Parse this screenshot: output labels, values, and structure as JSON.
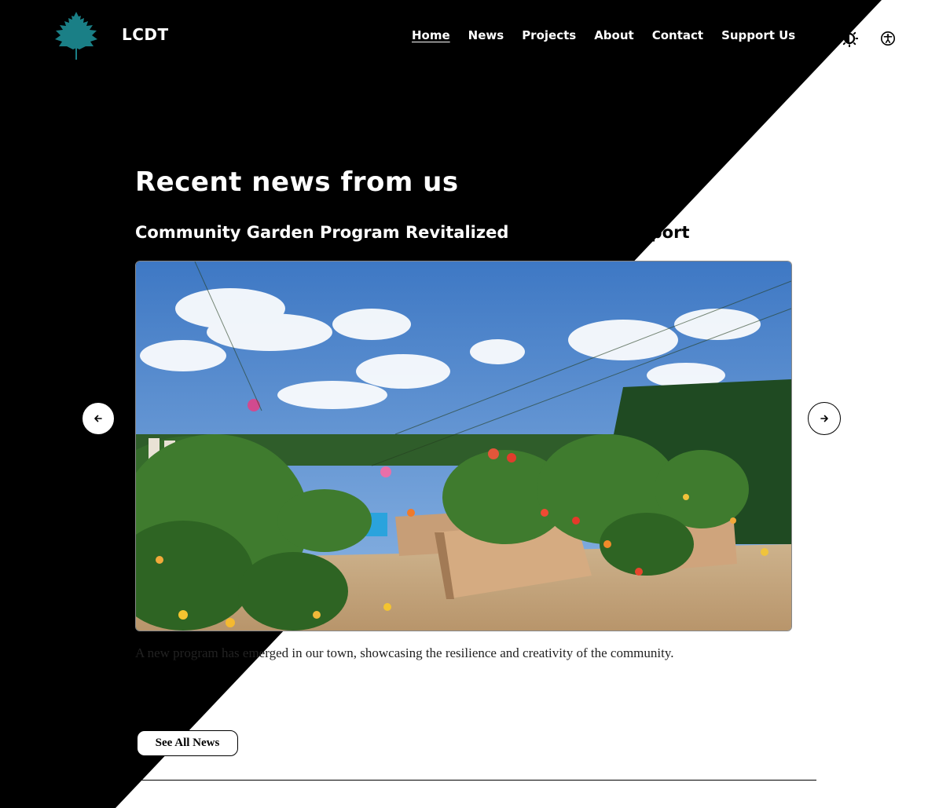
{
  "header": {
    "brand": "LCDT",
    "nav": [
      {
        "label": "Home",
        "active": true
      },
      {
        "label": "News",
        "active": false
      },
      {
        "label": "Projects",
        "active": false
      },
      {
        "label": "About",
        "active": false
      },
      {
        "label": "Contact",
        "active": false
      },
      {
        "label": "Support Us",
        "active": false
      }
    ],
    "icons": {
      "logo": "leaf-logo",
      "theme": "sun-icon",
      "accessibility": "accessibility-icon"
    }
  },
  "news": {
    "heading": "Recent news from us",
    "article": {
      "title_part1": "Community Garden Program Revitalized",
      "title_part2": " with Local Support",
      "summary": "A new program has emerged in our town, showcasing the resilience and creativity of the community."
    },
    "see_all_label": "See All News"
  },
  "colors": {
    "background_dark": "#000000",
    "background_light": "#ffffff",
    "brand_teal": "#1a7f86"
  }
}
